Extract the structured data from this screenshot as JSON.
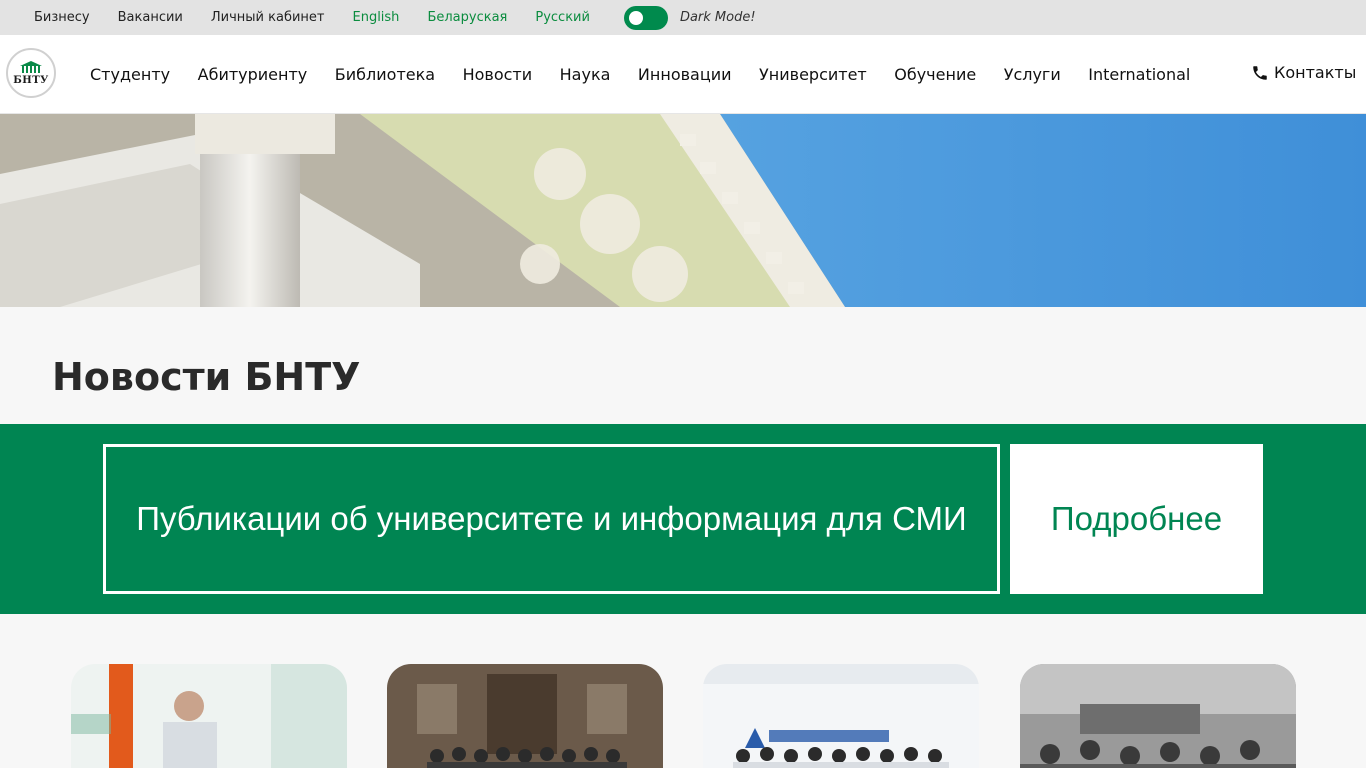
{
  "topbar": {
    "links": [
      "Бизнесу",
      "Вакансии",
      "Личный кабинет"
    ],
    "languages": [
      "English",
      "Беларуская",
      "Русский"
    ],
    "dark_mode_label": "Dark Mode!",
    "dark_mode_enabled": true
  },
  "header": {
    "logo_text": "БНТУ",
    "nav": [
      "Студенту",
      "Абитуриенту",
      "Библиотека",
      "Новости",
      "Наука",
      "Инновации",
      "Университет",
      "Обучение",
      "Услуги",
      "International"
    ],
    "contacts_label": "Контакты"
  },
  "page": {
    "title": "Новости БНТУ"
  },
  "banner": {
    "publications_text": "Публикации об университете и информация для СМИ",
    "more_label": "Подробнее"
  },
  "colors": {
    "brand_green": "#008552",
    "link_green": "#0b8c3f",
    "topbar_bg": "#e3e3e3"
  }
}
